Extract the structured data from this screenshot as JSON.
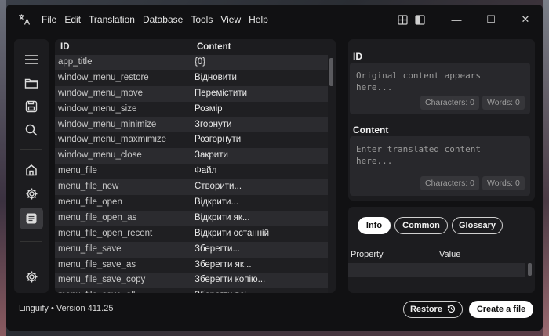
{
  "app": {
    "icon": "translate-icon"
  },
  "menu": [
    "File",
    "Edit",
    "Translation",
    "Database",
    "Tools",
    "View",
    "Help"
  ],
  "title_controls": {
    "layout_icon": "grid-layout-icon",
    "split_icon": "split-view-icon",
    "minimize": "—",
    "maximize": "☐",
    "close": "✕"
  },
  "rail": {
    "items": [
      {
        "icon": "hamburger-menu-icon"
      },
      {
        "icon": "folder-icon"
      },
      {
        "icon": "save-icon"
      },
      {
        "icon": "search-icon"
      },
      {
        "icon": "home-icon"
      },
      {
        "icon": "settings-icon"
      },
      {
        "icon": "document-icon",
        "active": true
      },
      {
        "icon": "settings-icon"
      }
    ]
  },
  "table": {
    "headers": {
      "id": "ID",
      "content": "Content"
    },
    "rows": [
      {
        "id": "app_title",
        "content": "{0}"
      },
      {
        "id": "window_menu_restore",
        "content": "Відновити"
      },
      {
        "id": "window_menu_move",
        "content": "Перемістити"
      },
      {
        "id": "window_menu_size",
        "content": "Розмір"
      },
      {
        "id": "window_menu_minimize",
        "content": "Згорнути"
      },
      {
        "id": "window_menu_maxmimize",
        "content": "Розгорнути"
      },
      {
        "id": "window_menu_close",
        "content": "Закрити"
      },
      {
        "id": "menu_file",
        "content": "Файл"
      },
      {
        "id": "menu_file_new",
        "content": "Створити..."
      },
      {
        "id": "menu_file_open",
        "content": "Відкрити..."
      },
      {
        "id": "menu_file_open_as",
        "content": "Відкрити як..."
      },
      {
        "id": "menu_file_open_recent",
        "content": "Відкрити останній"
      },
      {
        "id": "menu_file_save",
        "content": "Зберегти..."
      },
      {
        "id": "menu_file_save_as",
        "content": "Зберегти як..."
      },
      {
        "id": "menu_file_save_copy",
        "content": "Зберегти копію..."
      },
      {
        "id": "menu_file_save_all",
        "content": "Зберегти всі"
      }
    ]
  },
  "editor": {
    "id_title": "ID",
    "original_placeholder": "Original content appears here...",
    "original_chars": "Characters: 0",
    "original_words": "Words: 0",
    "content_title": "Content",
    "translated_placeholder": "Enter translated content here...",
    "translated_chars": "Characters: 0",
    "translated_words": "Words: 0"
  },
  "info": {
    "tabs": [
      "Info",
      "Common",
      "Glossary"
    ],
    "active_tab": "Info",
    "property_header": "Property",
    "value_header": "Value"
  },
  "footer": {
    "version": "Linguify • Version 411.25",
    "restore_label": "Restore",
    "create_label": "Create a file"
  }
}
